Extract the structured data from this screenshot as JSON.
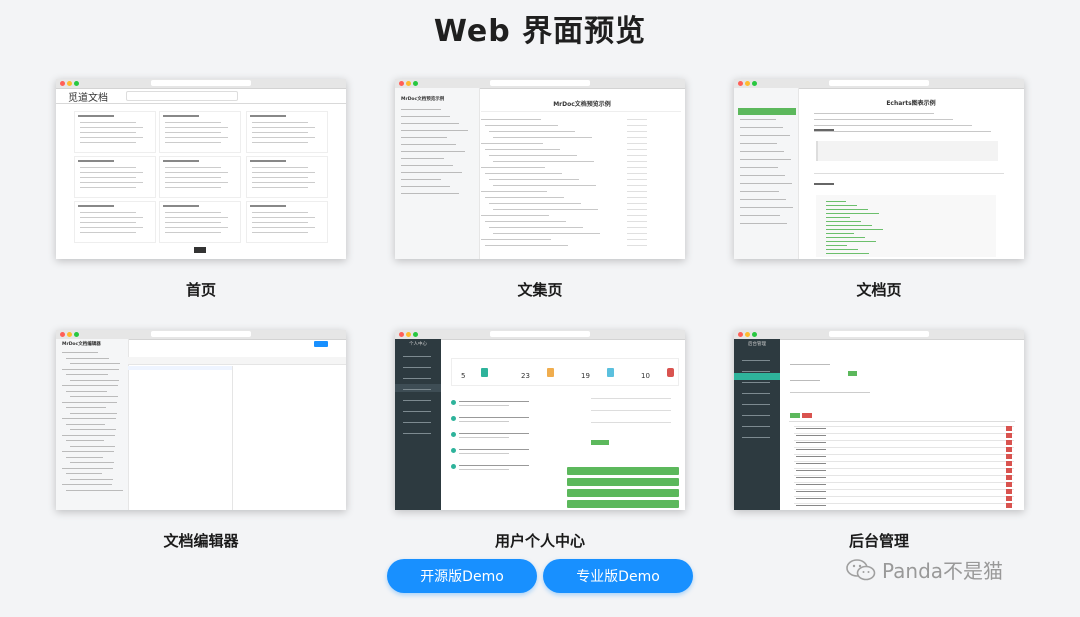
{
  "header": {
    "title": "Web 界面预览"
  },
  "screens": [
    {
      "caption": "首页",
      "inner_title": "觅道文档"
    },
    {
      "caption": "文集页",
      "inner_title": "MrDoc文档预览示例"
    },
    {
      "caption": "文档页",
      "inner_title": "Echarts图表示例"
    },
    {
      "caption": "文档编辑器",
      "inner_title": "MrDoc文档编辑器"
    },
    {
      "caption": "用户个人中心",
      "inner_title": "个人中心",
      "stats": [
        "5",
        "23",
        "19",
        "10"
      ]
    },
    {
      "caption": "后台管理",
      "inner_title": "后台管理"
    }
  ],
  "buttons": {
    "open_source": "开源版Demo",
    "pro": "专业版Demo"
  },
  "watermark": {
    "text": "Panda不是猫",
    "icon": "wechat-icon"
  },
  "colors": {
    "accent": "#1890ff",
    "green": "#5cb85c",
    "dark_sidebar": "#2d3a40"
  }
}
